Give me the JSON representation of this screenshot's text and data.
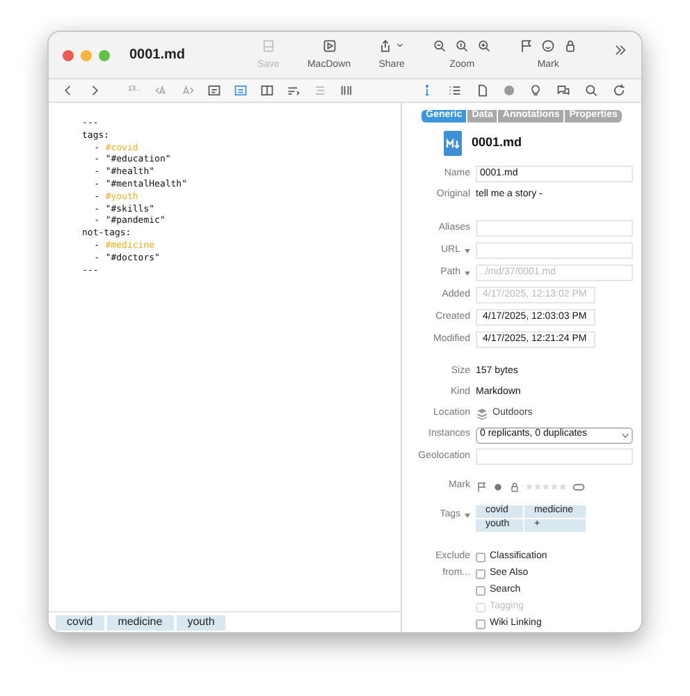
{
  "window": {
    "title": "0001.md"
  },
  "toolbar": [
    {
      "kind": "save",
      "label": "Save",
      "disabled": true
    },
    {
      "kind": "macdown",
      "label": "MacDown",
      "disabled": false
    },
    {
      "kind": "share",
      "label": "Share",
      "disabled": false
    },
    {
      "kind": "zoom",
      "label": "Zoom",
      "disabled": false
    },
    {
      "kind": "mark",
      "label": "Mark",
      "disabled": false
    }
  ],
  "format_bar": {
    "line_count": "13..."
  },
  "editor": {
    "delimiter_open": "---",
    "delimiter_close": "---",
    "sections": [
      {
        "key": "tags:",
        "items": [
          {
            "bullet": "-",
            "value": "#covid",
            "highlighted": true
          },
          {
            "bullet": "-",
            "value": "\"#education\"",
            "highlighted": false
          },
          {
            "bullet": "-",
            "value": "\"#health\"",
            "highlighted": false
          },
          {
            "bullet": "-",
            "value": "\"#mentalHealth\"",
            "highlighted": false
          },
          {
            "bullet": "-",
            "value": "#youth",
            "highlighted": true
          },
          {
            "bullet": "-",
            "value": "\"#skills\"",
            "highlighted": false
          },
          {
            "bullet": "-",
            "value": "\"#pandemic\"",
            "highlighted": false
          }
        ]
      },
      {
        "key": "not-tags:",
        "items": [
          {
            "bullet": "-",
            "value": "#medicine",
            "highlighted": true
          },
          {
            "bullet": "-",
            "value": "\"#doctors\"",
            "highlighted": false
          }
        ]
      }
    ]
  },
  "editor_tags": [
    "covid",
    "medicine",
    "youth"
  ],
  "inspector": {
    "tabs": [
      {
        "label": "Generic",
        "selected": true
      },
      {
        "label": "Data",
        "selected": false
      },
      {
        "label": "Annotations",
        "selected": false
      },
      {
        "label": "Properties",
        "selected": false
      }
    ],
    "file_name": "0001.md",
    "fields": [
      {
        "kind": "input",
        "label": "Name",
        "value": "0001.md",
        "disabled": false
      },
      {
        "kind": "text",
        "label": "Original",
        "value": "tell me a story -"
      },
      {
        "kind": "gap"
      },
      {
        "kind": "input",
        "label": "Aliases"
      },
      {
        "kind": "input",
        "label": "URL",
        "menu": true
      },
      {
        "kind": "input",
        "label": "Path",
        "menu": true,
        "value": "../md/37/0001.md",
        "disabled": true
      },
      {
        "kind": "date",
        "label": "Added",
        "value": "4/17/2025, 12:13:02 PM",
        "disabled": true
      },
      {
        "kind": "date",
        "label": "Created",
        "value": "4/17/2025, 12:03:03 PM",
        "disabled": false
      },
      {
        "kind": "date",
        "label": "Modified",
        "value": "4/17/2025, 12:21:24 PM",
        "disabled": false
      },
      {
        "kind": "gap"
      },
      {
        "kind": "text",
        "label": "Size",
        "value": "157 bytes"
      },
      {
        "kind": "text",
        "label": "Kind",
        "value": "Markdown"
      },
      {
        "kind": "location",
        "label": "Location",
        "value": "Outdoors"
      },
      {
        "kind": "select",
        "label": "Instances",
        "value": "0 replicants, 0 duplicates"
      },
      {
        "kind": "input",
        "label": "Geolocation"
      }
    ],
    "mark": {
      "label": "Mark",
      "stars": 0
    },
    "tags": {
      "label": "Tags",
      "items": [
        "covid",
        "medicine",
        "youth"
      ],
      "add": "+"
    },
    "exclude": {
      "label": "Exclude from...",
      "options": [
        {
          "label": "Classification",
          "checked": false,
          "disabled": false
        },
        {
          "label": "See Also",
          "checked": false,
          "disabled": false
        },
        {
          "label": "Search",
          "checked": false,
          "disabled": false
        },
        {
          "label": "Tagging",
          "checked": false,
          "disabled": true
        },
        {
          "label": "Wiki Linking",
          "checked": false,
          "disabled": false
        }
      ]
    }
  }
}
